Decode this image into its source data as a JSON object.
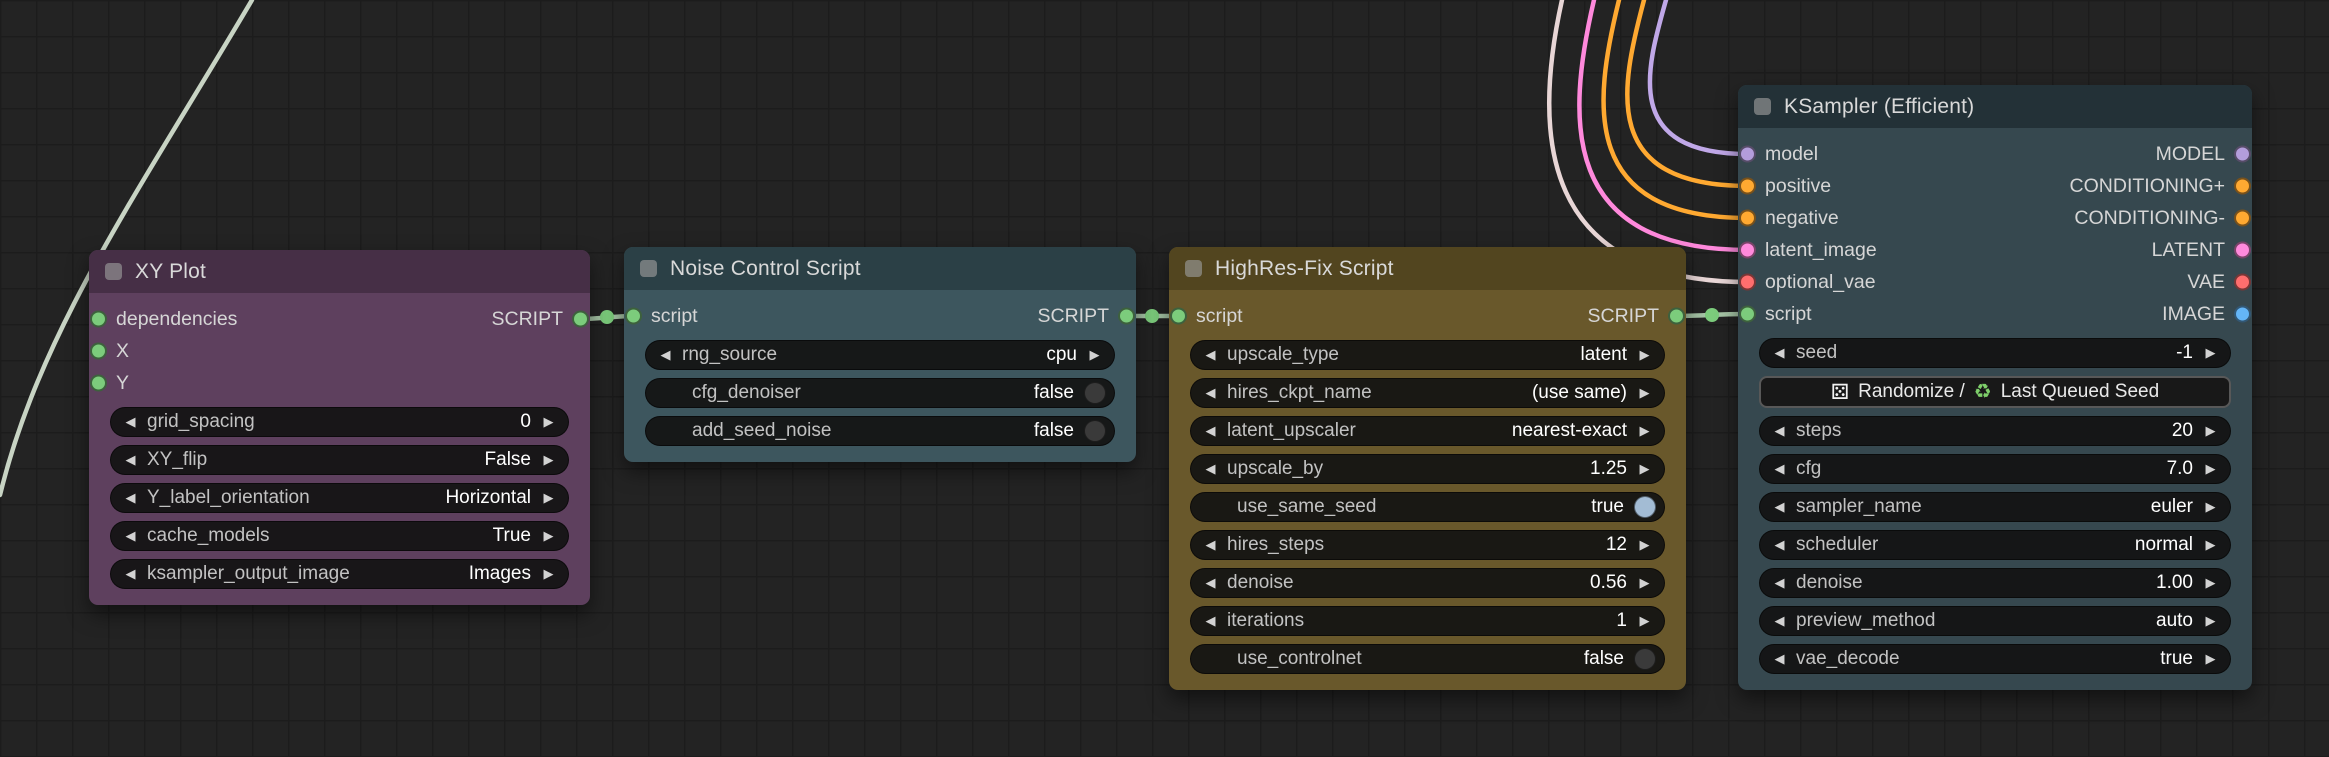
{
  "icons": {
    "left_arrow": "◀",
    "right_arrow": "▶",
    "dice": "⚄",
    "recycle": "♻"
  },
  "colors": {
    "script": "#7ccc7c",
    "model": "#b39ddb",
    "conditioning": "#ffa931",
    "latent": "#ff89dc",
    "vae": "#ff6e6e",
    "image": "#64b5f6",
    "wire_script": "#a6c5a6",
    "wire_model": "#c0a8e8",
    "wire_conditioning": "#ffa931",
    "wire_latent": "#ff89dc",
    "wire_vae": "#e8d6d6",
    "wire_stray": "#c8d4c4",
    "toggle_on": "#a3bcd4",
    "toggle_off": "#3a3a3a"
  },
  "nodes": [
    {
      "title": "XY Plot",
      "header_color": "#462f46",
      "body_color": "#5e405e",
      "inputs": [
        {
          "label": "dependencies",
          "color": "#7ccc7c"
        },
        {
          "label": "X",
          "color": "#7ccc7c"
        },
        {
          "label": "Y",
          "color": "#7ccc7c"
        }
      ],
      "outputs": [
        {
          "label": "SCRIPT",
          "color": "#7ccc7c"
        }
      ],
      "widgets": [
        {
          "label": "grid_spacing",
          "value": "0"
        },
        {
          "label": "XY_flip",
          "value": "False"
        },
        {
          "label": "Y_label_orientation",
          "value": "Horizontal"
        },
        {
          "label": "cache_models",
          "value": "True"
        },
        {
          "label": "ksampler_output_image",
          "value": "Images"
        }
      ]
    },
    {
      "title": "Noise Control Script",
      "header_color": "#2b4046",
      "body_color": "#3d565e",
      "inputs": [
        {
          "label": "script",
          "color": "#7ccc7c"
        }
      ],
      "outputs": [
        {
          "label": "SCRIPT",
          "color": "#7ccc7c"
        }
      ],
      "widgets": [
        {
          "label": "rng_source",
          "value": "cpu"
        },
        {
          "label": "cfg_denoiser",
          "value": "false"
        },
        {
          "label": "add_seed_noise",
          "value": "false"
        }
      ]
    },
    {
      "title": "HighRes-Fix Script",
      "header_color": "#52451f",
      "body_color": "#69582b",
      "inputs": [
        {
          "label": "script",
          "color": "#7ccc7c"
        }
      ],
      "outputs": [
        {
          "label": "SCRIPT",
          "color": "#7ccc7c"
        }
      ],
      "widgets": [
        {
          "label": "upscale_type",
          "value": "latent"
        },
        {
          "label": "hires_ckpt_name",
          "value": "(use same)"
        },
        {
          "label": "latent_upscaler",
          "value": "nearest-exact"
        },
        {
          "label": "upscale_by",
          "value": "1.25"
        },
        {
          "label": "use_same_seed",
          "value": "true"
        },
        {
          "label": "hires_steps",
          "value": "12"
        },
        {
          "label": "denoise",
          "value": "0.56"
        },
        {
          "label": "iterations",
          "value": "1"
        },
        {
          "label": "use_controlnet",
          "value": "false"
        }
      ]
    },
    {
      "title": "KSampler (Efficient)",
      "header_color": "#233137",
      "body_color": "#36484f",
      "io": [
        {
          "in": "model",
          "in_color": "#b39ddb",
          "out": "MODEL",
          "out_color": "#b39ddb"
        },
        {
          "in": "positive",
          "in_color": "#ffa931",
          "out": "CONDITIONING+",
          "out_color": "#ffa931"
        },
        {
          "in": "negative",
          "in_color": "#ffa931",
          "out": "CONDITIONING-",
          "out_color": "#ffa931"
        },
        {
          "in": "latent_image",
          "in_color": "#ff89dc",
          "out": "LATENT",
          "out_color": "#ff89dc"
        },
        {
          "in": "optional_vae",
          "in_color": "#ff6e6e",
          "out": "VAE",
          "out_color": "#ff6e6e"
        },
        {
          "in": "script",
          "in_color": "#7ccc7c",
          "out": "IMAGE",
          "out_color": "#64b5f6"
        }
      ],
      "widgets": [
        {
          "label": "seed",
          "value": "-1"
        },
        {
          "button_text_left": "Randomize /",
          "button_text_right": "Last Queued Seed"
        },
        {
          "label": "steps",
          "value": "20"
        },
        {
          "label": "cfg",
          "value": "7.0"
        },
        {
          "label": "sampler_name",
          "value": "euler"
        },
        {
          "label": "scheduler",
          "value": "normal"
        },
        {
          "label": "denoise",
          "value": "1.00"
        },
        {
          "label": "preview_method",
          "value": "auto"
        },
        {
          "label": "vae_decode",
          "value": "true"
        }
      ]
    }
  ]
}
